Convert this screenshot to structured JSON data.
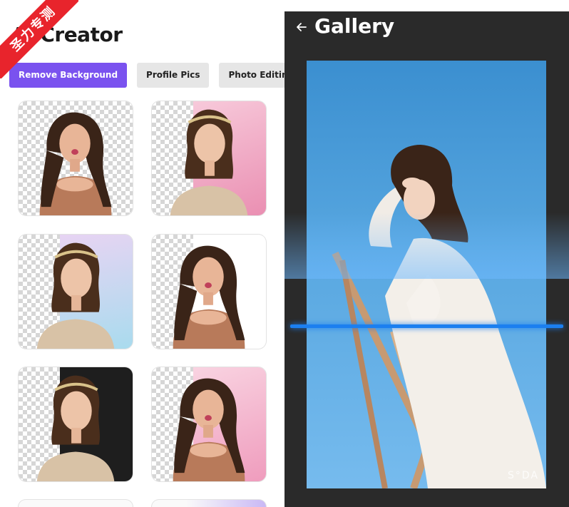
{
  "left_panel": {
    "title": "AI Creator",
    "chips": [
      {
        "label": "Remove Background",
        "active": true
      },
      {
        "label": "Profile Pics",
        "active": false
      },
      {
        "label": "Photo Editing Cla",
        "active": false
      }
    ]
  },
  "right_panel": {
    "title": "Gallery",
    "watermark": "S°DA"
  },
  "ribbon": {
    "text": "圣力专测"
  },
  "colors": {
    "accent": "#7a52ef",
    "scan_line": "#1b7ff0",
    "panel_dark": "#2a2a2a",
    "ribbon": "#e8242c"
  }
}
